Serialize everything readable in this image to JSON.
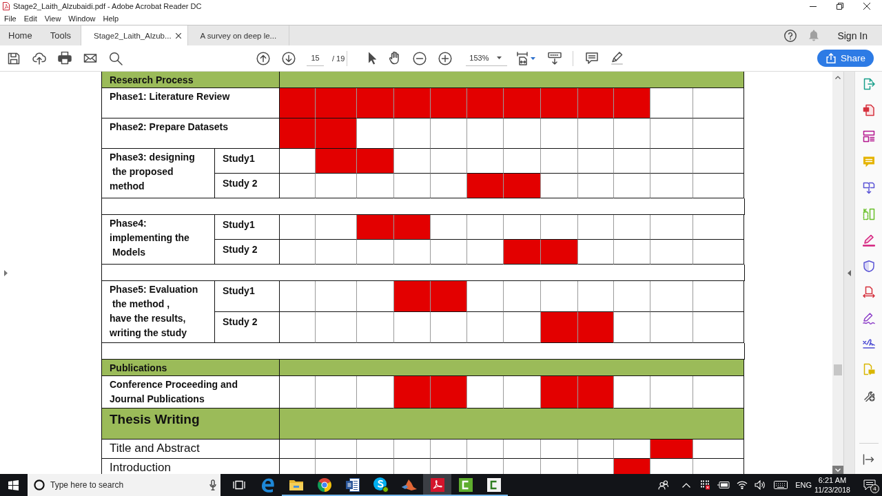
{
  "window": {
    "title": "Stage2_Laith_Alzubaidi.pdf - Adobe Acrobat Reader DC"
  },
  "menu": [
    "File",
    "Edit",
    "View",
    "Window",
    "Help"
  ],
  "tabs": [
    {
      "label": "Home",
      "kind": "nav",
      "selected": false
    },
    {
      "label": "Tools",
      "kind": "nav",
      "selected": false
    },
    {
      "label": "Stage2_Laith_Alzub...",
      "kind": "document",
      "selected": true
    },
    {
      "label": "A survey on deep le...",
      "kind": "document",
      "selected": false
    }
  ],
  "account": {
    "sign_in": "Sign In"
  },
  "toolbar": {
    "page": "15",
    "page_total": "/ 19",
    "zoom": "153%",
    "share": "Share"
  },
  "document": {
    "rows": [
      {
        "kind": "section",
        "label": "Research Process"
      },
      {
        "kind": "task",
        "label": "Phase1: Literature Review",
        "filled": [
          true,
          true,
          true,
          true,
          true,
          true,
          true,
          true,
          true,
          true,
          false,
          false
        ]
      },
      {
        "kind": "task",
        "label": "Phase2: Prepare Datasets",
        "filled": [
          true,
          true,
          false,
          false,
          false,
          false,
          false,
          false,
          false,
          false,
          false,
          false
        ]
      },
      {
        "kind": "phase",
        "label": "Phase3: designing\n the proposed\nmethod",
        "studies": [
          {
            "label": "Study1",
            "filled": [
              false,
              true,
              true,
              false,
              false,
              false,
              false,
              false,
              false,
              false,
              false,
              false
            ]
          },
          {
            "label": "Study 2",
            "filled": [
              false,
              false,
              false,
              false,
              false,
              true,
              true,
              false,
              false,
              false,
              false,
              false
            ]
          }
        ]
      },
      {
        "kind": "spacer"
      },
      {
        "kind": "phase",
        "label": "Phase4:\nimplementing the\n Models",
        "studies": [
          {
            "label": "Study1",
            "filled": [
              false,
              false,
              true,
              true,
              false,
              false,
              false,
              false,
              false,
              false,
              false,
              false
            ]
          },
          {
            "label": "Study 2",
            "filled": [
              false,
              false,
              false,
              false,
              false,
              false,
              true,
              true,
              false,
              false,
              false,
              false
            ]
          }
        ]
      },
      {
        "kind": "spacer"
      },
      {
        "kind": "phase",
        "label": "Phase5: Evaluation\n the method ,\nhave the results,\nwriting the study",
        "studies": [
          {
            "label": "Study1",
            "filled": [
              false,
              false,
              false,
              true,
              true,
              false,
              false,
              false,
              false,
              false,
              false,
              false
            ]
          },
          {
            "label": "Study 2",
            "filled": [
              false,
              false,
              false,
              false,
              false,
              false,
              false,
              true,
              true,
              false,
              false,
              false
            ]
          }
        ]
      },
      {
        "kind": "spacer"
      },
      {
        "kind": "section",
        "label": "Publications"
      },
      {
        "kind": "task",
        "label": "Conference Proceeding and\nJournal Publications",
        "filled": [
          false,
          false,
          false,
          true,
          true,
          false,
          false,
          true,
          true,
          false,
          false,
          false
        ]
      },
      {
        "kind": "chapter",
        "label": "Thesis Writing"
      },
      {
        "kind": "entry",
        "label": "Title and Abstract",
        "filled": [
          false,
          false,
          false,
          false,
          false,
          false,
          false,
          false,
          false,
          false,
          true,
          false
        ]
      },
      {
        "kind": "entry",
        "label": "Introduction",
        "filled": [
          false,
          false,
          false,
          false,
          false,
          false,
          false,
          false,
          false,
          true,
          false,
          false
        ]
      }
    ]
  },
  "taskbar": {
    "search": {
      "placeholder": "Type here to search"
    },
    "apps": [
      {
        "kind": "ebrowser",
        "running": false,
        "selected": false
      },
      {
        "kind": "folder",
        "running": true,
        "selected": false
      },
      {
        "kind": "roundbrowser",
        "running": true,
        "selected": false
      },
      {
        "kind": "wordproc",
        "running": true,
        "selected": false
      },
      {
        "kind": "chat",
        "running": true,
        "selected": false
      },
      {
        "kind": "peaks",
        "running": true,
        "selected": false
      },
      {
        "kind": "pdfreader",
        "running": true,
        "selected": true
      },
      {
        "kind": "recorder",
        "running": true,
        "selected": false
      },
      {
        "kind": "recorderlight",
        "running": true,
        "selected": false
      }
    ],
    "language": "ENG",
    "time": "6:21 AM",
    "date": "11/23/2018",
    "notifications": "4"
  }
}
